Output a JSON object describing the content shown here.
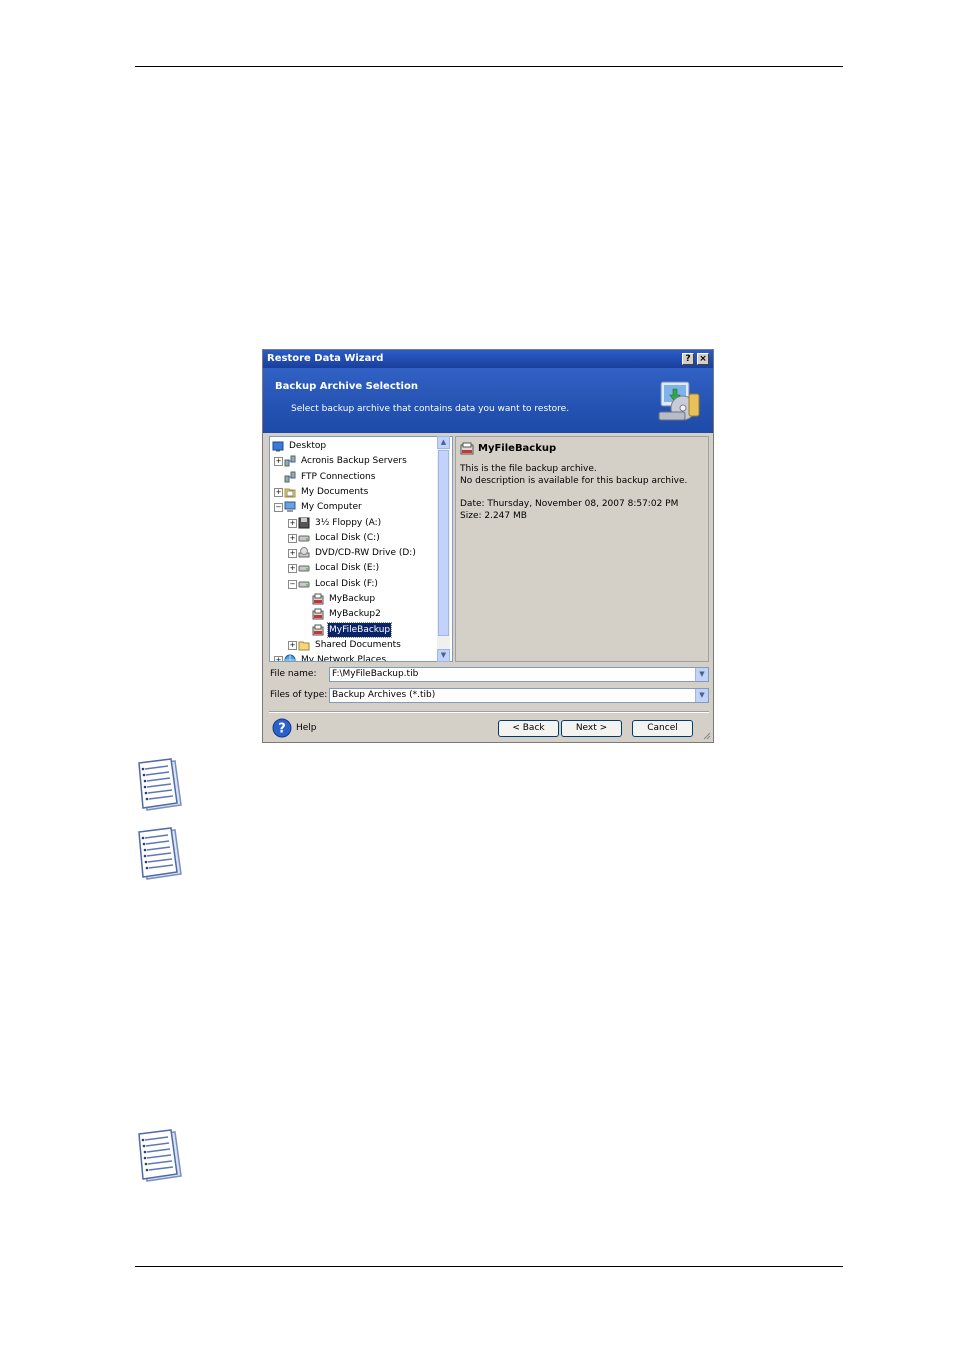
{
  "window": {
    "title": "Restore Data Wizard",
    "help_glyph": "?",
    "close_glyph": "×"
  },
  "header": {
    "title": "Backup Archive Selection",
    "subtitle": "Select backup archive that contains data you want to restore."
  },
  "tree": {
    "items": [
      {
        "label": "Desktop",
        "icon": "desktop-icon",
        "expander": "",
        "depth": 0
      },
      {
        "label": "Acronis Backup Servers",
        "icon": "network-servers-icon",
        "expander": "+",
        "depth": 1
      },
      {
        "label": "FTP Connections",
        "icon": "network-servers-icon",
        "expander": "",
        "depth": 1
      },
      {
        "label": "My Documents",
        "icon": "folder-docs-icon",
        "expander": "+",
        "depth": 1
      },
      {
        "label": "My Computer",
        "icon": "computer-icon",
        "expander": "−",
        "depth": 1
      },
      {
        "label": "3½ Floppy (A:)",
        "icon": "floppy-icon",
        "expander": "+",
        "depth": 2
      },
      {
        "label": "Local Disk (C:)",
        "icon": "disk-icon",
        "expander": "+",
        "depth": 2
      },
      {
        "label": "DVD/CD-RW Drive (D:)",
        "icon": "dvd-icon",
        "expander": "+",
        "depth": 2
      },
      {
        "label": "Local Disk (E:)",
        "icon": "disk-icon",
        "expander": "+",
        "depth": 2
      },
      {
        "label": "Local Disk (F:)",
        "icon": "disk-icon",
        "expander": "−",
        "depth": 2
      },
      {
        "label": "MyBackup",
        "icon": "archive-icon",
        "expander": "",
        "depth": 3
      },
      {
        "label": "MyBackup2",
        "icon": "archive-icon",
        "expander": "",
        "depth": 3
      },
      {
        "label": "MyFileBackup",
        "icon": "archive-icon",
        "expander": "",
        "depth": 3,
        "selected": true
      },
      {
        "label": "Shared Documents",
        "icon": "folder-icon",
        "expander": "+",
        "depth": 2
      },
      {
        "label": "My Network Places",
        "icon": "network-icon",
        "expander": "+",
        "depth": 1
      }
    ]
  },
  "info": {
    "name": "MyFileBackup",
    "line1": "This is the file backup archive.",
    "line2": "No description is available for this backup archive.",
    "date": "Date: Thursday, November 08, 2007 8:57:02 PM",
    "size": "Size: 2.247 MB"
  },
  "fields": {
    "file_name_label": "File name:",
    "file_name_value": "F:\\MyFileBackup.tib",
    "file_type_label": "Files of type:",
    "file_type_value": "Backup Archives (*.tib)"
  },
  "buttons": {
    "help": "Help",
    "back": "< Back",
    "next": "Next >",
    "cancel": "Cancel"
  },
  "colors": {
    "title_bar": "#1a3f9c",
    "header": "#2556b8",
    "selection": "#0a246a"
  }
}
